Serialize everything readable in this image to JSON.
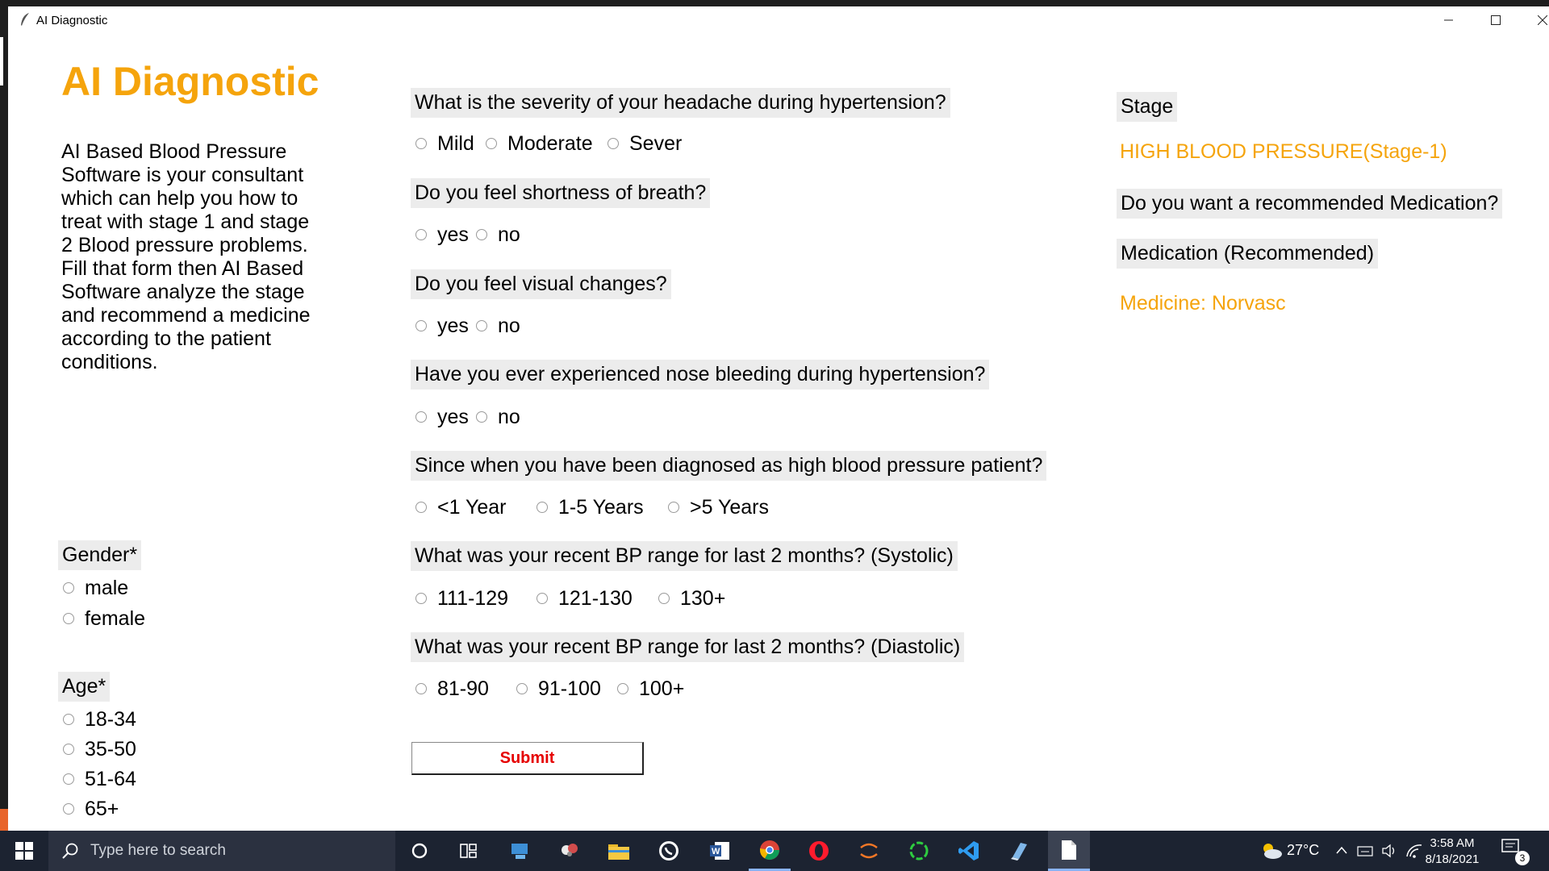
{
  "window": {
    "title": "AI Diagnostic"
  },
  "sidebar": {
    "heading": "AI Diagnostic",
    "description": "AI Based Blood Pressure Software is your consultant which can help you how to treat with stage 1 and stage 2 Blood pressure problems. Fill that form then AI Based Software analyze the stage and recommend a medicine according to the patient conditions.",
    "gender_label": "Gender*",
    "gender_options": [
      "male",
      "female"
    ],
    "age_label": "Age*",
    "age_options": [
      "18-34",
      "35-50",
      "51-64",
      "65+"
    ]
  },
  "questions": [
    {
      "text": "What is the severity of your headache during hypertension?",
      "options": [
        "Mild",
        "Moderate",
        "Sever"
      ]
    },
    {
      "text": "Do you feel shortness of breath?",
      "options": [
        "yes",
        "no"
      ]
    },
    {
      "text": "Do you feel visual changes?",
      "options": [
        "yes",
        "no"
      ]
    },
    {
      "text": "Have you ever experienced nose bleeding during hypertension?",
      "options": [
        "yes",
        "no"
      ]
    },
    {
      "text": "Since when you have been diagnosed as high blood pressure patient?",
      "options": [
        "<1 Year",
        "1-5 Years",
        ">5 Years"
      ]
    },
    {
      "text": "What was your recent BP range for last 2 months? (Systolic)",
      "options": [
        "111-129",
        "121-130",
        "130+"
      ]
    },
    {
      "text": "What was your recent BP range for last 2 months? (Diastolic)",
      "options": [
        "81-90",
        "91-100",
        "100+"
      ]
    }
  ],
  "submit_label": "Submit",
  "results": {
    "stage_label": "Stage",
    "stage_value": "HIGH BLOOD PRESSURE(Stage-1)",
    "medication_question": "Do you want a recommended Medication?",
    "medication_label": "Medication (Recommended)",
    "medication_value": "Medicine: Norvasc"
  },
  "taskbar": {
    "search_placeholder": "Type here to search",
    "temperature": "27°C",
    "time": "3:58 AM",
    "date": "8/18/2021",
    "notification_count": "3"
  },
  "colors": {
    "accent": "#f5a40c",
    "submit_text": "#e60000",
    "label_bg": "#ececec"
  }
}
